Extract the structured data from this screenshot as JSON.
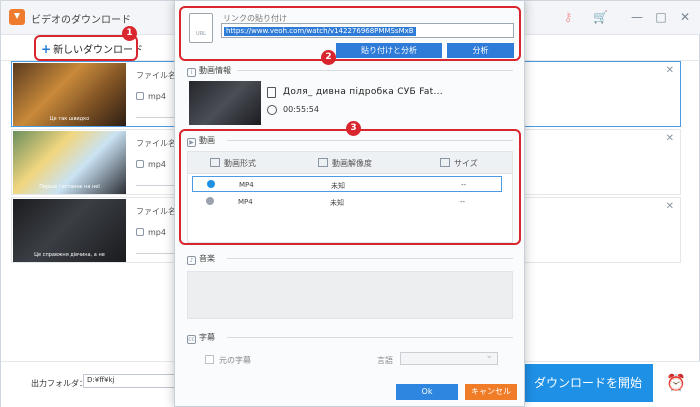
{
  "app": {
    "title": "ビデオのダウンロード"
  },
  "toolbar": {
    "new_download": "新しいダウンロード"
  },
  "list": {
    "items": [
      {
        "filename_label": "ファイル名：",
        "format": "mp4",
        "subtitle": "Це так швидко"
      },
      {
        "filename_label": "ファイル名：",
        "format": "mp4",
        "subtitle": "Перша і останнє на неї"
      },
      {
        "filename_label": "ファイル名：Д",
        "format": "mp4",
        "subtitle": "Це справжня дівчина, а не"
      }
    ]
  },
  "bottom": {
    "output_label": "出力フォルダ：",
    "output_value": "D:¥ff¥kj",
    "download_start": "ダウンロードを開始"
  },
  "dialog": {
    "link_title": "リンクの貼り付け",
    "url_icon_text": "URL",
    "url_value": "https://www.veoh.com/watch/v142276968PMMSsMxB",
    "paste_analyze": "貼り付けと分析",
    "analyze": "分析",
    "info_section": "動画情報",
    "video_title": "Доля_ дивна підробка СУБ Fat...",
    "duration": "00:55:54",
    "video_section": "動画",
    "table": {
      "headers": [
        "動画形式",
        "動画解像度",
        "サイズ"
      ],
      "rows": [
        {
          "format": "MP4",
          "resolution": "未知",
          "size": "--",
          "selected": true
        },
        {
          "format": "MP4",
          "resolution": "未知",
          "size": "--",
          "selected": false
        }
      ]
    },
    "audio_section": "音楽",
    "subtitle_section": "字幕",
    "original_subtitle": "元の字幕",
    "language_label": "言語",
    "ok": "Ok",
    "cancel": "キャンセル"
  },
  "annotations": [
    "1",
    "2",
    "3"
  ],
  "colors": {
    "highlight": "#d9262e",
    "accent": "#1e90e6",
    "cancel": "#f07c27"
  }
}
